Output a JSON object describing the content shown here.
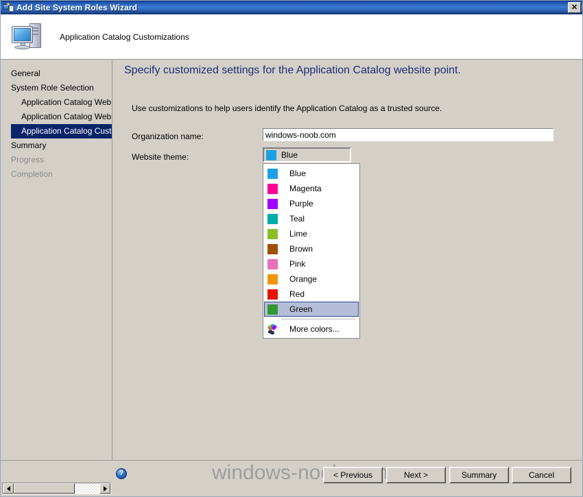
{
  "window": {
    "title": "Add Site System Roles Wizard",
    "close_label": "✕",
    "icon": "wizard-computer-icon"
  },
  "header": {
    "title": "Application Catalog Customizations",
    "icon": "computer-icon"
  },
  "sidebar": {
    "items": [
      {
        "label": "General",
        "indent": false,
        "state": "normal"
      },
      {
        "label": "System Role Selection",
        "indent": false,
        "state": "normal"
      },
      {
        "label": "Application Catalog Web Service Point",
        "indent": true,
        "state": "normal"
      },
      {
        "label": "Application Catalog Website Point",
        "indent": true,
        "state": "normal"
      },
      {
        "label": "Application Catalog Customizations",
        "indent": true,
        "state": "selected"
      },
      {
        "label": "Summary",
        "indent": false,
        "state": "normal"
      },
      {
        "label": "Progress",
        "indent": false,
        "state": "disabled"
      },
      {
        "label": "Completion",
        "indent": false,
        "state": "disabled"
      }
    ],
    "scrollbar": {
      "left_arrow": "◀",
      "right_arrow": "▶"
    }
  },
  "main": {
    "heading": "Specify customized settings for the Application Catalog website point.",
    "description": "Use customizations to help users identify the Application Catalog as a trusted source.",
    "heading_color": "#1f2b7b",
    "organization": {
      "label": "Organization name:",
      "value": "windows-noob.com",
      "placeholder": ""
    },
    "theme": {
      "label": "Website theme:",
      "selected": "Blue",
      "selected_color": "#1ba1e2",
      "options": [
        {
          "label": "Blue",
          "color": "#1ba1e2",
          "highlighted": false
        },
        {
          "label": "Magenta",
          "color": "#ff0097",
          "highlighted": false
        },
        {
          "label": "Purple",
          "color": "#a200ff",
          "highlighted": false
        },
        {
          "label": "Teal",
          "color": "#00aba9",
          "highlighted": false
        },
        {
          "label": "Lime",
          "color": "#8cbf26",
          "highlighted": false
        },
        {
          "label": "Brown",
          "color": "#a05000",
          "highlighted": false
        },
        {
          "label": "Pink",
          "color": "#e671b8",
          "highlighted": false
        },
        {
          "label": "Orange",
          "color": "#f09609",
          "highlighted": false
        },
        {
          "label": "Red",
          "color": "#e51400",
          "highlighted": false
        },
        {
          "label": "Green",
          "color": "#339933",
          "highlighted": true
        }
      ],
      "more_colors_label": "More colors...",
      "more_colors_icon": "color-palette-icon"
    }
  },
  "footer": {
    "help_icon": "?",
    "watermark": "windows-noob.com",
    "buttons": {
      "previous": "< Previous",
      "next": "Next >",
      "summary": "Summary",
      "cancel": "Cancel"
    }
  }
}
